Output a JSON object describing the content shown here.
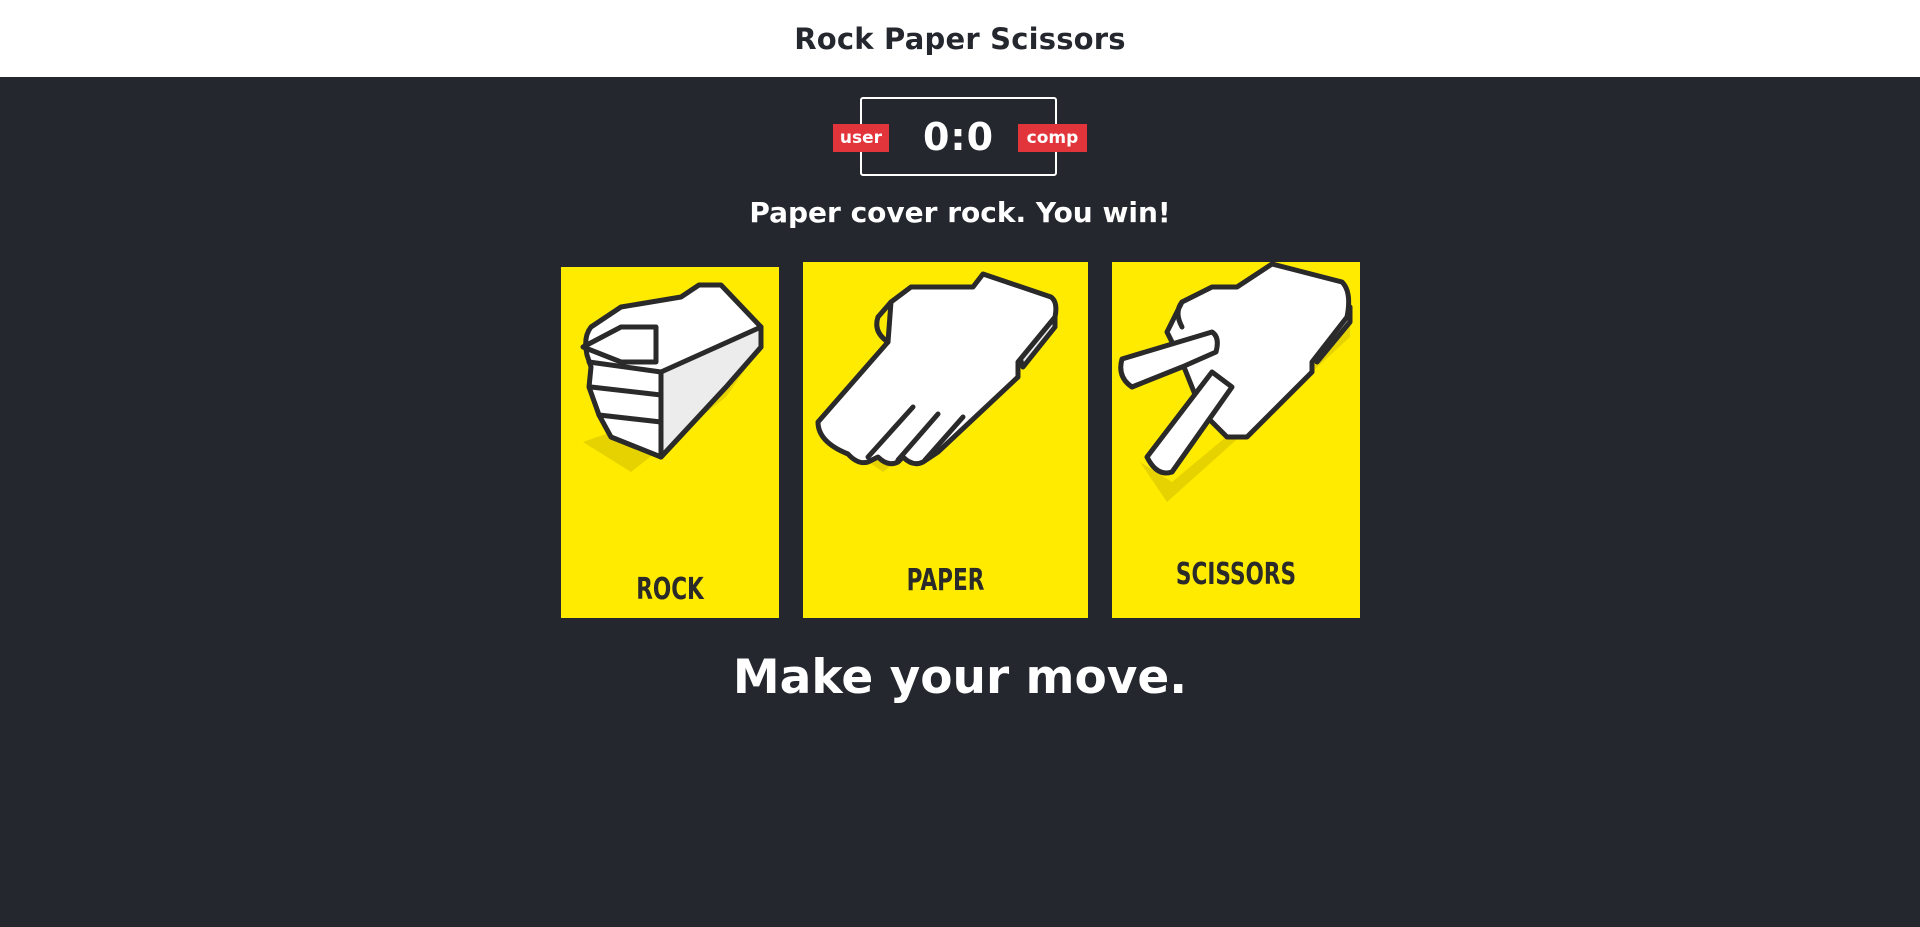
{
  "header": {
    "title": "Rock Paper Scissors"
  },
  "scoreboard": {
    "user_label": "user",
    "score": "0:0",
    "comp_label": "comp"
  },
  "result": {
    "message": "Paper cover rock. You win!"
  },
  "choices": [
    {
      "id": "rock",
      "label": "ROCK",
      "icon": "fist-icon"
    },
    {
      "id": "paper",
      "label": "PAPER",
      "icon": "open-hand-icon"
    },
    {
      "id": "scissors",
      "label": "SCISSORS",
      "icon": "two-fingers-icon"
    }
  ],
  "prompt": {
    "text": "Make your move."
  },
  "colors": {
    "background": "#24272e",
    "header_bg": "#ffffff",
    "card_yellow": "#ffeb00",
    "badge_red": "#e2353b",
    "hand_white": "#ffffff",
    "outline": "#2a2a2a"
  }
}
